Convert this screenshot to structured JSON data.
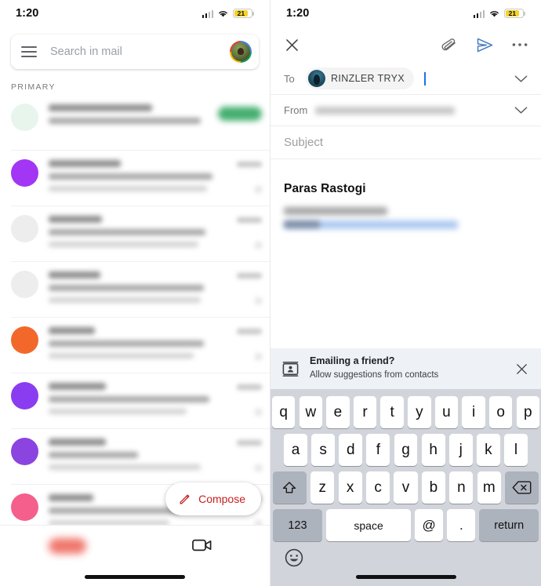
{
  "status_bar": {
    "time": "1:20",
    "battery_level": "21",
    "battery_color": "#f5d328",
    "signal_icon": "cellular-bars-icon",
    "wifi_icon": "wifi-icon"
  },
  "inbox": {
    "menu_icon": "hamburger-menu-icon",
    "search_placeholder": "Search in mail",
    "avatar_icon": "account-avatar",
    "category_label": "PRIMARY",
    "rows": [
      {
        "avatar_color": "#e8f5ec",
        "has_badge": true,
        "badge_color": "#1e9e52",
        "lines": 2
      },
      {
        "avatar_color": "#a335f5",
        "has_badge": false,
        "lines": 3
      },
      {
        "avatar_color": "#e8e8e8",
        "has_badge": false,
        "lines": 3
      },
      {
        "avatar_color": "#e8e8e8",
        "has_badge": false,
        "lines": 3
      },
      {
        "avatar_color": "#f2682a",
        "has_badge": false,
        "lines": 3
      },
      {
        "avatar_color": "#8a3df0",
        "has_badge": false,
        "lines": 3
      },
      {
        "avatar_color": "#8b44e0",
        "has_badge": false,
        "lines": 3
      },
      {
        "avatar_color": "#f45f8c",
        "has_badge": false,
        "lines": 3
      }
    ],
    "compose": {
      "label": "Compose",
      "icon": "pencil-icon",
      "color": "#c5221f"
    },
    "bottom_nav": [
      {
        "name": "mail",
        "icon": "mail-icon"
      },
      {
        "name": "meet",
        "icon": "video-camera-icon"
      }
    ]
  },
  "compose": {
    "close_icon": "close-icon",
    "attach_icon": "paperclip-icon",
    "send_icon": "send-icon",
    "more_icon": "more-options-icon",
    "send_color": "#4a7fc1",
    "to": {
      "label": "To",
      "recipient": "RINZLER TRYX",
      "expand_icon": "chevron-down-icon"
    },
    "from": {
      "label": "From",
      "expand_icon": "chevron-down-icon"
    },
    "subject_placeholder": "Subject",
    "signature_name": "Paras Rastogi"
  },
  "suggestion_banner": {
    "icon": "contacts-card-icon",
    "title": "Emailing a friend?",
    "subtitle": "Allow suggestions from contacts",
    "close_icon": "close-icon"
  },
  "keyboard": {
    "row1": [
      "q",
      "w",
      "e",
      "r",
      "t",
      "y",
      "u",
      "i",
      "o",
      "p"
    ],
    "row2": [
      "a",
      "s",
      "d",
      "f",
      "g",
      "h",
      "j",
      "k",
      "l"
    ],
    "row3": [
      "z",
      "x",
      "c",
      "v",
      "b",
      "n",
      "m"
    ],
    "shift_icon": "shift-icon",
    "backspace_icon": "backspace-icon",
    "numbers_key": "123",
    "space_key": "space",
    "at_key": "@",
    "period_key": ".",
    "return_key": "return",
    "emoji_icon": "emoji-icon"
  }
}
